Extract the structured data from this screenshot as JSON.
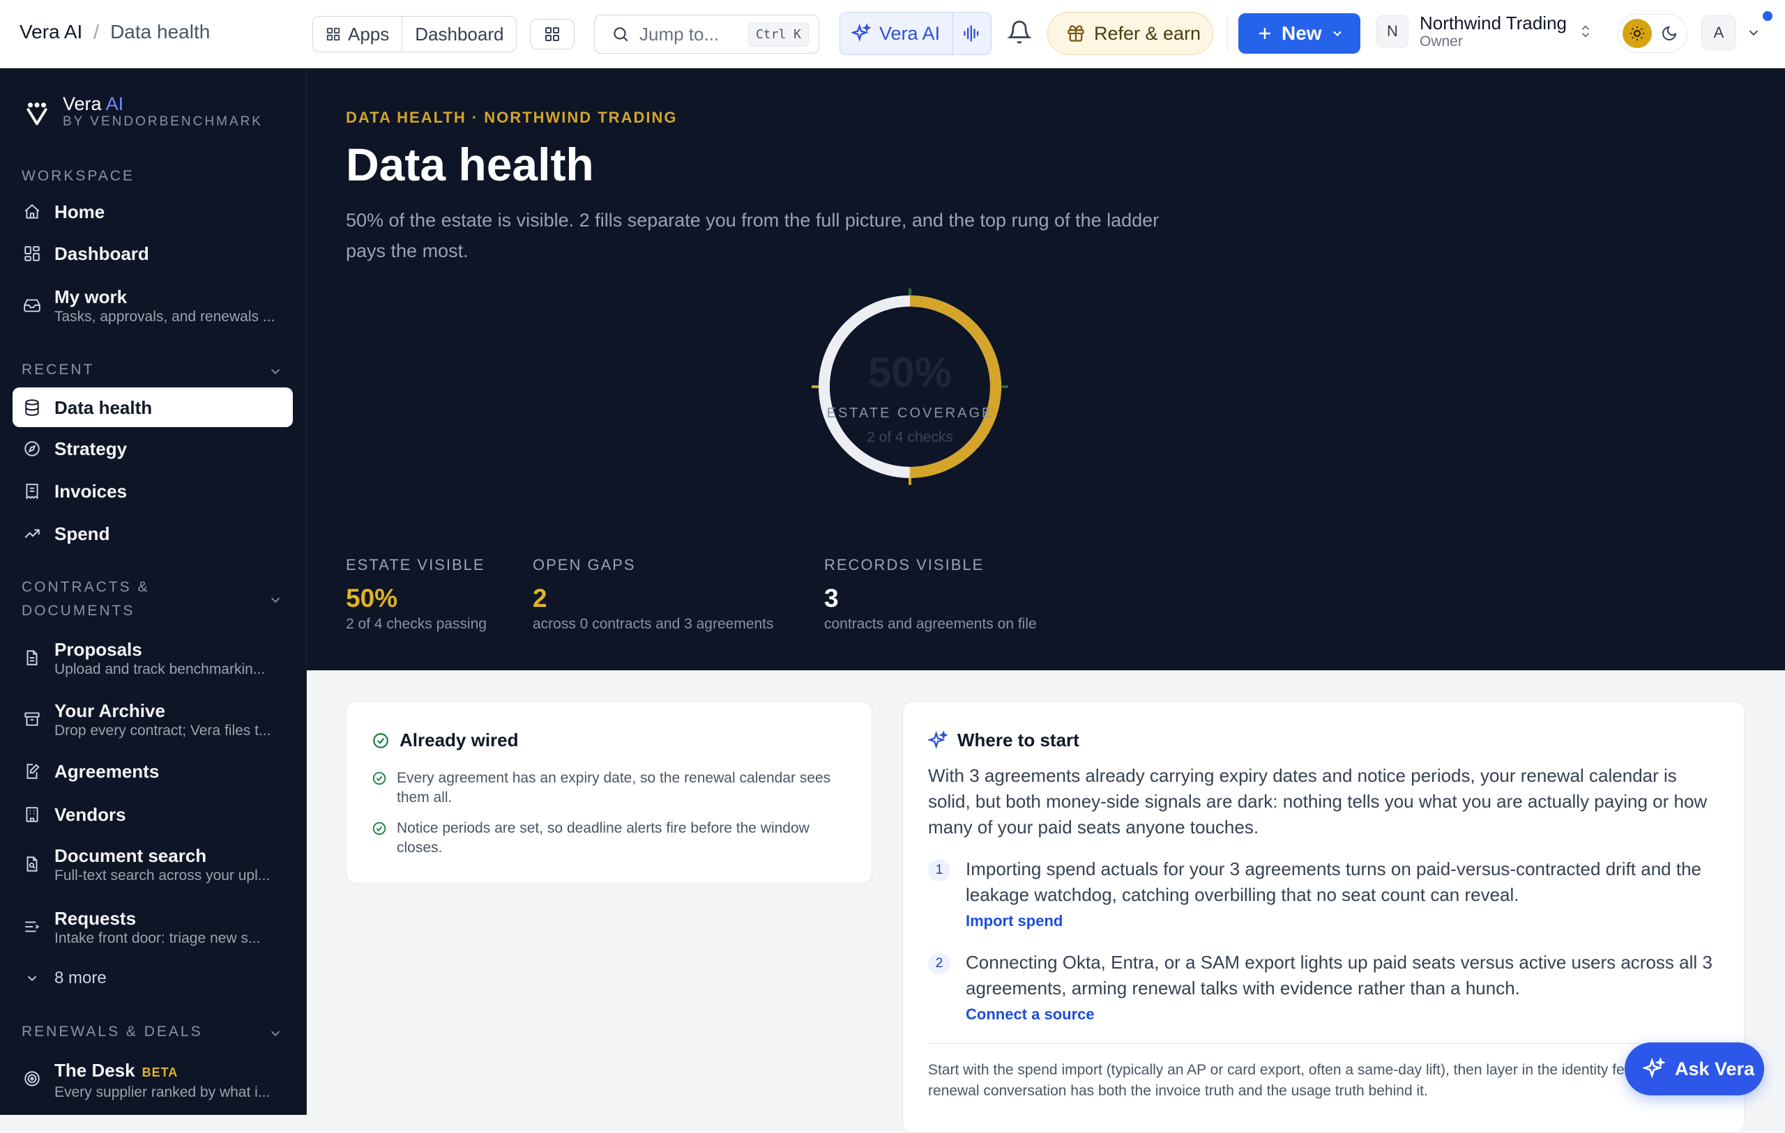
{
  "topbar": {
    "app": "Vera AI",
    "page": "Data health",
    "apps_label": "Apps",
    "dashboard_label": "Dashboard",
    "search_placeholder": "Jump to...",
    "search_kbd": "Ctrl K",
    "vera_label": "Vera AI",
    "refer_label": "Refer & earn",
    "new_label": "New",
    "org_avatar": "N",
    "org_name": "Northwind Trading",
    "org_role": "Owner",
    "user_avatar": "A"
  },
  "sidebar": {
    "brand_name": "Vera",
    "brand_ai": "AI",
    "brand_by": "BY VENDORBENCHMARK",
    "workspace_title": "WORKSPACE",
    "workspace": [
      {
        "label": "Home",
        "icon": "home-icon"
      },
      {
        "label": "Dashboard",
        "icon": "dashboard-icon"
      },
      {
        "label": "My work",
        "sub": "Tasks, approvals, and renewals ...",
        "icon": "inbox-icon"
      }
    ],
    "recent_title": "RECENT",
    "recent": [
      {
        "label": "Data health",
        "icon": "database-icon",
        "active": true
      },
      {
        "label": "Strategy",
        "icon": "compass-icon"
      },
      {
        "label": "Invoices",
        "icon": "receipt-icon"
      },
      {
        "label": "Spend",
        "icon": "trend-icon"
      }
    ],
    "contracts_title_1": "CONTRACTS &",
    "contracts_title_2": "DOCUMENTS",
    "contracts": [
      {
        "label": "Proposals",
        "sub": "Upload and track benchmarkin...",
        "icon": "file-icon"
      },
      {
        "label": "Your Archive",
        "sub": "Drop every contract; Vera files t...",
        "icon": "archive-icon"
      },
      {
        "label": "Agreements",
        "icon": "pen-file-icon"
      },
      {
        "label": "Vendors",
        "icon": "building-icon"
      },
      {
        "label": "Document search",
        "sub": "Full-text search across your upl...",
        "icon": "file-search-icon"
      },
      {
        "label": "Requests",
        "sub": "Intake front door: triage new s...",
        "icon": "list-icon"
      }
    ],
    "more_label": "8 more",
    "renewals_title": "RENEWALS & DEALS",
    "desk": {
      "label": "The Desk",
      "badge": "BETA",
      "sub": "Every supplier ranked by what i..."
    }
  },
  "hero": {
    "kicker": "DATA HEALTH · NORTHWIND TRADING",
    "title": "Data health",
    "lede": "50% of the estate is visible. 2 fills separate you from the full picture, and the top rung of the ladder pays the most.",
    "gauge_value": 0.5,
    "gauge_pct": "50%",
    "gauge_label": "ESTATE COVERAGE",
    "gauge_sub": "2 of 4 checks",
    "stats": [
      {
        "label": "ESTATE VISIBLE",
        "value": "50%",
        "sub": "2 of 4 checks passing",
        "color": "#e0b323"
      },
      {
        "label": "OPEN GAPS",
        "value": "2",
        "sub": "across 0 contracts and 3 agreements",
        "color": "#e0b323"
      },
      {
        "label": "RECORDS VISIBLE",
        "value": "3",
        "sub": "contracts and agreements on file",
        "color": "#ffffff"
      }
    ]
  },
  "wired": {
    "title": "Already wired",
    "items": [
      "Every agreement has an expiry date, so the renewal calendar sees them all.",
      "Notice periods are set, so deadline alerts fire before the window closes."
    ]
  },
  "start": {
    "title": "Where to start",
    "intro": "With 3 agreements already carrying expiry dates and notice periods, your renewal calendar is solid, but both money-side signals are dark: nothing tells you what you are actually paying or how many of your paid seats anyone touches.",
    "steps": [
      {
        "num": "1",
        "text": "Importing spend actuals for your 3 agreements turns on paid-versus-contracted drift and the leakage watchdog, catching overbilling that no seat count can reveal.",
        "link": "Import spend"
      },
      {
        "num": "2",
        "text": "Connecting Okta, Entra, or a SAM export lights up paid seats versus active users across all 3 agreements, arming renewal talks with evidence rather than a hunch.",
        "link": "Connect a source"
      }
    ],
    "footer": "Start with the spend import (typically an AP or card export, often a same-day lift), then layer in the identity feed so every renewal conversation has both the invoice truth and the usage truth behind it."
  },
  "ask": {
    "label": "Ask Vera"
  },
  "colors": {
    "accent": "#2563eb",
    "gold": "#d4a52a",
    "navy": "#0d1526"
  }
}
